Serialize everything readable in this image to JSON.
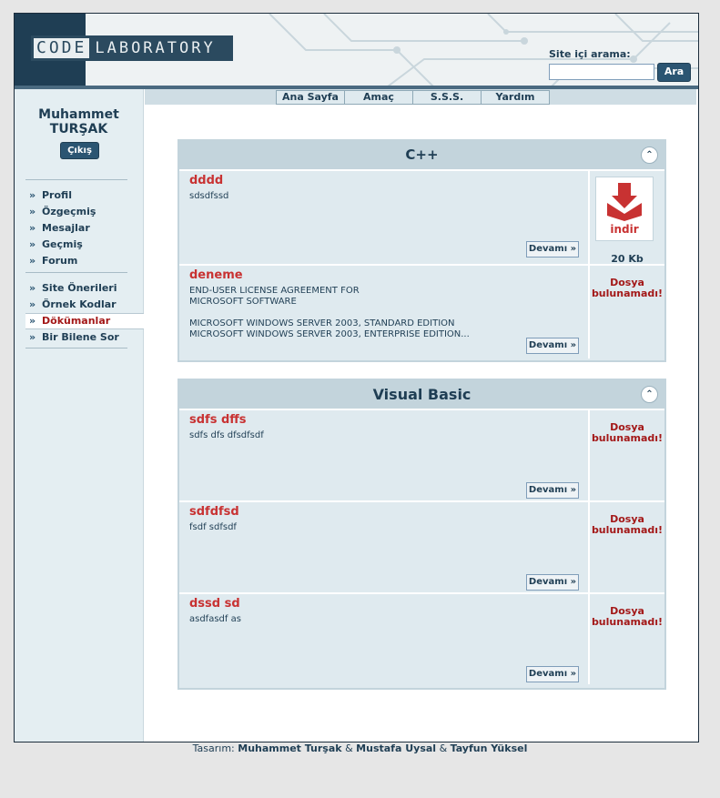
{
  "header": {
    "logo_code": "CODE",
    "logo_lab": "LABORATORY",
    "search_label": "Site içi arama:",
    "search_value": "",
    "search_button": "Ara"
  },
  "nav": {
    "tabs": [
      "Ana Sayfa",
      "Amaç",
      "S.S.S.",
      "Yardım"
    ]
  },
  "user": {
    "first": "Muhammet",
    "last": "TURŞAK",
    "logout": "Çıkış"
  },
  "sidebar": {
    "group1": [
      "Profil",
      "Özgeçmiş",
      "Mesajlar",
      "Geçmiş",
      "Forum"
    ],
    "group2": [
      "Site Önerileri",
      "Örnek Kodlar",
      "Dökümanlar",
      "Bir Bilene Sor"
    ],
    "active": "Dökümanlar"
  },
  "sections": [
    {
      "title": "C++",
      "items": [
        {
          "title": "dddd",
          "desc": "sdsdfssd",
          "more": "Devamı »",
          "download": "indir",
          "size": "20 Kb"
        },
        {
          "title": "deneme",
          "desc": "END-USER LICENSE AGREEMENT FOR\nMICROSOFT SOFTWARE\n\nMICROSOFT WINDOWS SERVER 2003, STANDARD EDITION\nMICROSOFT WINDOWS SERVER 2003, ENTERPRISE EDITION...",
          "more": "Devamı »",
          "notfound": "Dosya bulunamadı!"
        }
      ]
    },
    {
      "title": "Visual Basic",
      "items": [
        {
          "title": "sdfs dffs",
          "desc": "sdfs dfs dfsdfsdf",
          "more": "Devamı »",
          "notfound": "Dosya bulunamadı!"
        },
        {
          "title": "sdfdfsd",
          "desc": "fsdf sdfsdf",
          "more": "Devamı »",
          "notfound": "Dosya bulunamadı!"
        },
        {
          "title": "dssd sd",
          "desc": "asdfasdf as",
          "more": "Devamı »",
          "notfound": "Dosya bulunamadı!"
        }
      ]
    }
  ],
  "footer": {
    "prefix": "Tasarım:",
    "a1": "Muhammet Turşak",
    "amp": "&",
    "a2": "Mustafa Uysal",
    "a3": "Tayfun Yüksel"
  }
}
